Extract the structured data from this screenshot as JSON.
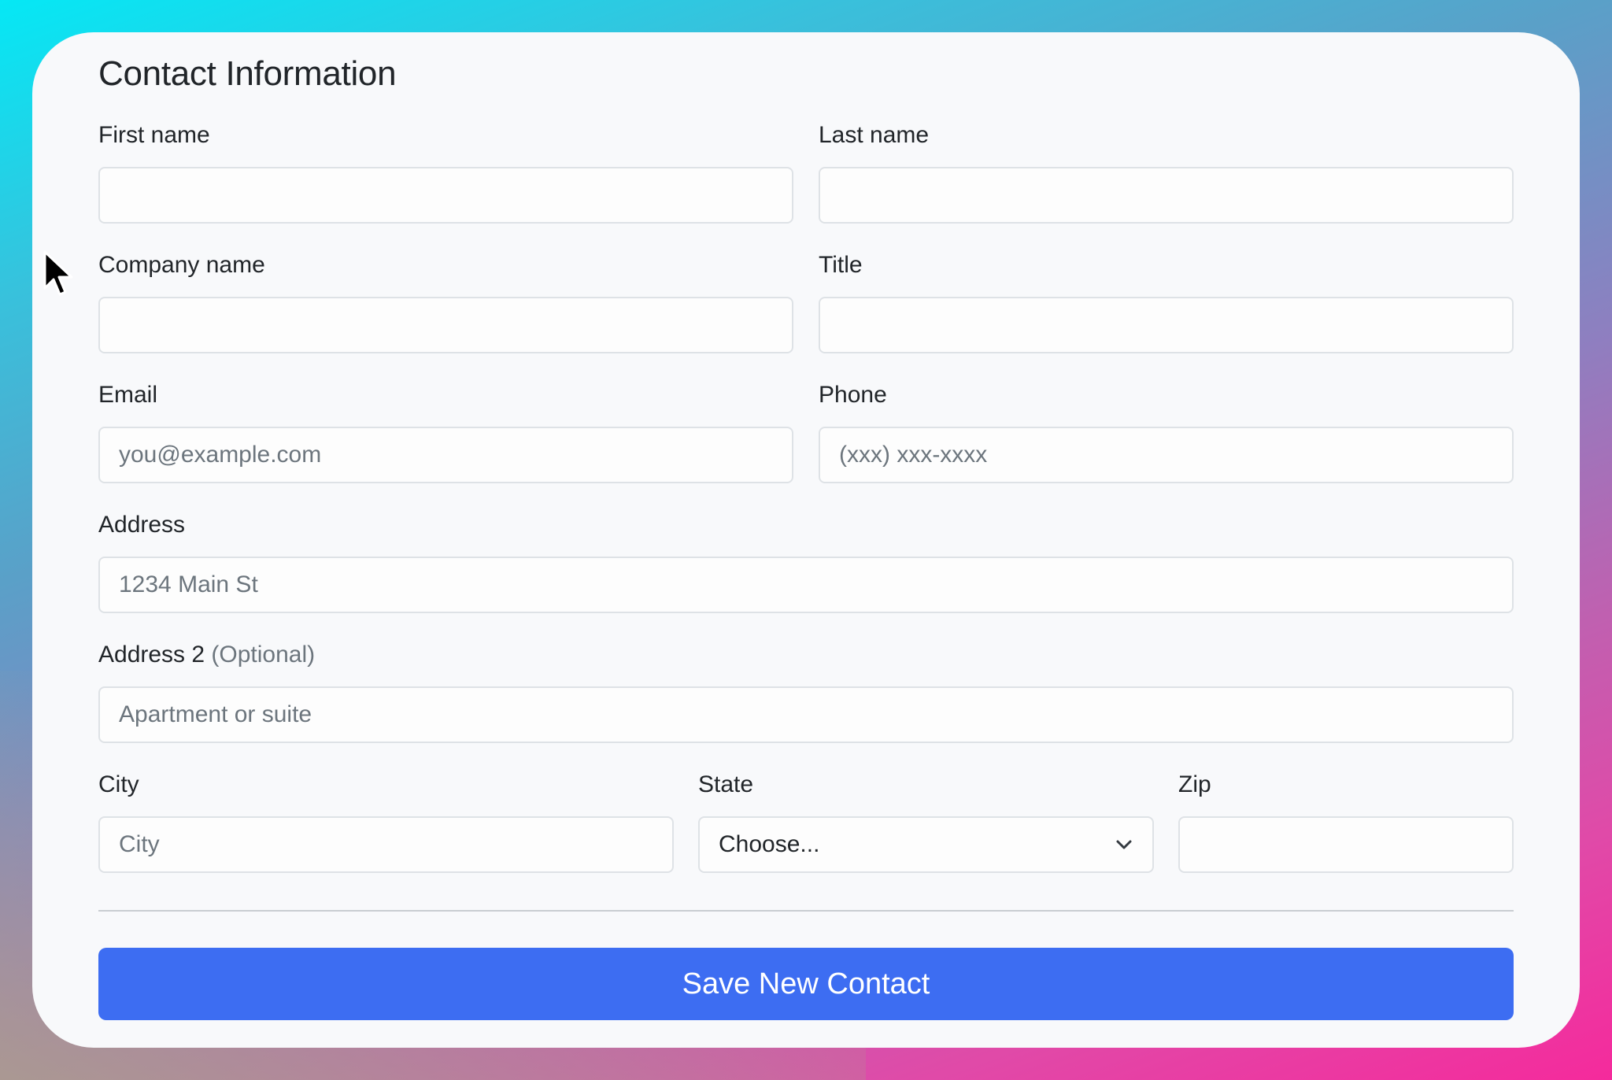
{
  "form": {
    "title": "Contact Information",
    "fields": {
      "first_name": {
        "label": "First name",
        "placeholder": "",
        "value": ""
      },
      "last_name": {
        "label": "Last name",
        "placeholder": "",
        "value": ""
      },
      "company_name": {
        "label": "Company name",
        "placeholder": "",
        "value": ""
      },
      "title": {
        "label": "Title",
        "placeholder": "",
        "value": ""
      },
      "email": {
        "label": "Email",
        "placeholder": "you@example.com",
        "value": ""
      },
      "phone": {
        "label": "Phone",
        "placeholder": "(xxx) xxx-xxxx",
        "value": ""
      },
      "address": {
        "label": "Address",
        "placeholder": "1234 Main St",
        "value": ""
      },
      "address2": {
        "label": "Address 2",
        "optional_note": "(Optional)",
        "placeholder": "Apartment or suite",
        "value": ""
      },
      "city": {
        "label": "City",
        "placeholder": "City",
        "value": ""
      },
      "state": {
        "label": "State",
        "selected": "Choose..."
      },
      "zip": {
        "label": "Zip",
        "placeholder": "",
        "value": ""
      }
    },
    "submit_label": "Save New Contact"
  },
  "icons": {
    "cursor": "mouse-pointer-icon",
    "select_chevron": "chevron-down-icon"
  },
  "colors": {
    "primary_button": "#3d6df2",
    "card_background": "#f8f9fb",
    "input_border": "#dee2e6",
    "placeholder_text": "#6c757d"
  }
}
